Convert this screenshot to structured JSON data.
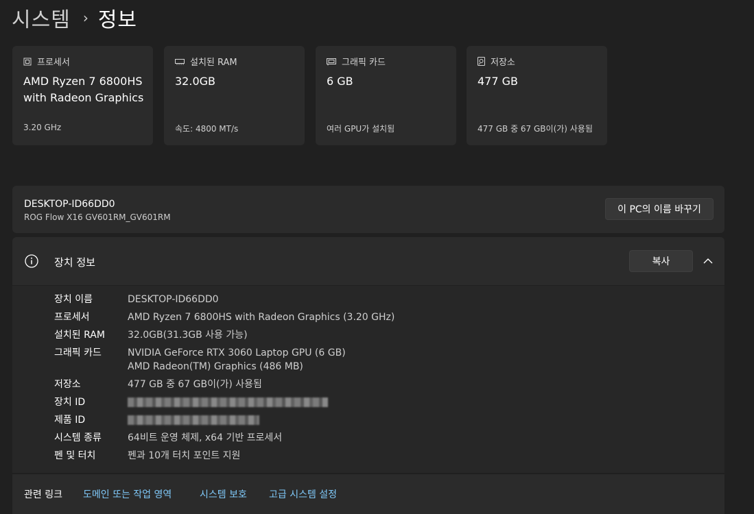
{
  "breadcrumb": {
    "parent": "시스템",
    "separator": "›",
    "current": "정보"
  },
  "cards": [
    {
      "label": "프로세서",
      "value": "AMD Ryzen 7 6800HS with Radeon Graphics",
      "sub": "3.20 GHz",
      "icon": "processor-icon"
    },
    {
      "label": "설치된 RAM",
      "value": "32.0GB",
      "sub": "속도: 4800 MT/s",
      "icon": "ram-icon"
    },
    {
      "label": "그래픽 카드",
      "value": "6 GB",
      "sub": "여러 GPU가 설치됨",
      "icon": "graphics-card-icon"
    },
    {
      "label": "저장소",
      "value": "477 GB",
      "sub": "477 GB 중 67 GB이(가) 사용됨",
      "icon": "storage-icon"
    }
  ],
  "device": {
    "name": "DESKTOP-ID66DD0",
    "model": "ROG Flow X16 GV601RM_GV601RM",
    "rename_label": "이 PC의 이름 바꾸기"
  },
  "specs": {
    "title": "장치 정보",
    "copy_label": "복사",
    "rows": [
      {
        "key": "장치 이름",
        "value": "DESKTOP-ID66DD0"
      },
      {
        "key": "프로세서",
        "value": "AMD Ryzen 7 6800HS with Radeon Graphics (3.20 GHz)"
      },
      {
        "key": "설치된 RAM",
        "value": "32.0GB(31.3GB 사용 가능)"
      },
      {
        "key": "그래픽 카드",
        "value": "NVIDIA GeForce RTX 3060 Laptop GPU (6 GB)",
        "value2": "AMD Radeon(TM) Graphics (486 MB)"
      },
      {
        "key": "저장소",
        "value": "477 GB 중 67 GB이(가) 사용됨"
      },
      {
        "key": "장치 ID",
        "value": ""
      },
      {
        "key": "제품 ID",
        "value": ""
      },
      {
        "key": "시스템 종류",
        "value": "64비트 운영 체제, x64 기반 프로세서"
      },
      {
        "key": "펜 및 터치",
        "value": "펜과 10개 터치 포인트 지원"
      }
    ]
  },
  "related": {
    "label": "관련 링크",
    "links": [
      "도메인 또는 작업 영역",
      "시스템 보호",
      "고급 시스템 설정"
    ]
  },
  "colors": {
    "background": "#202020",
    "card": "#2b2b2b",
    "link": "#7fc8f8"
  }
}
